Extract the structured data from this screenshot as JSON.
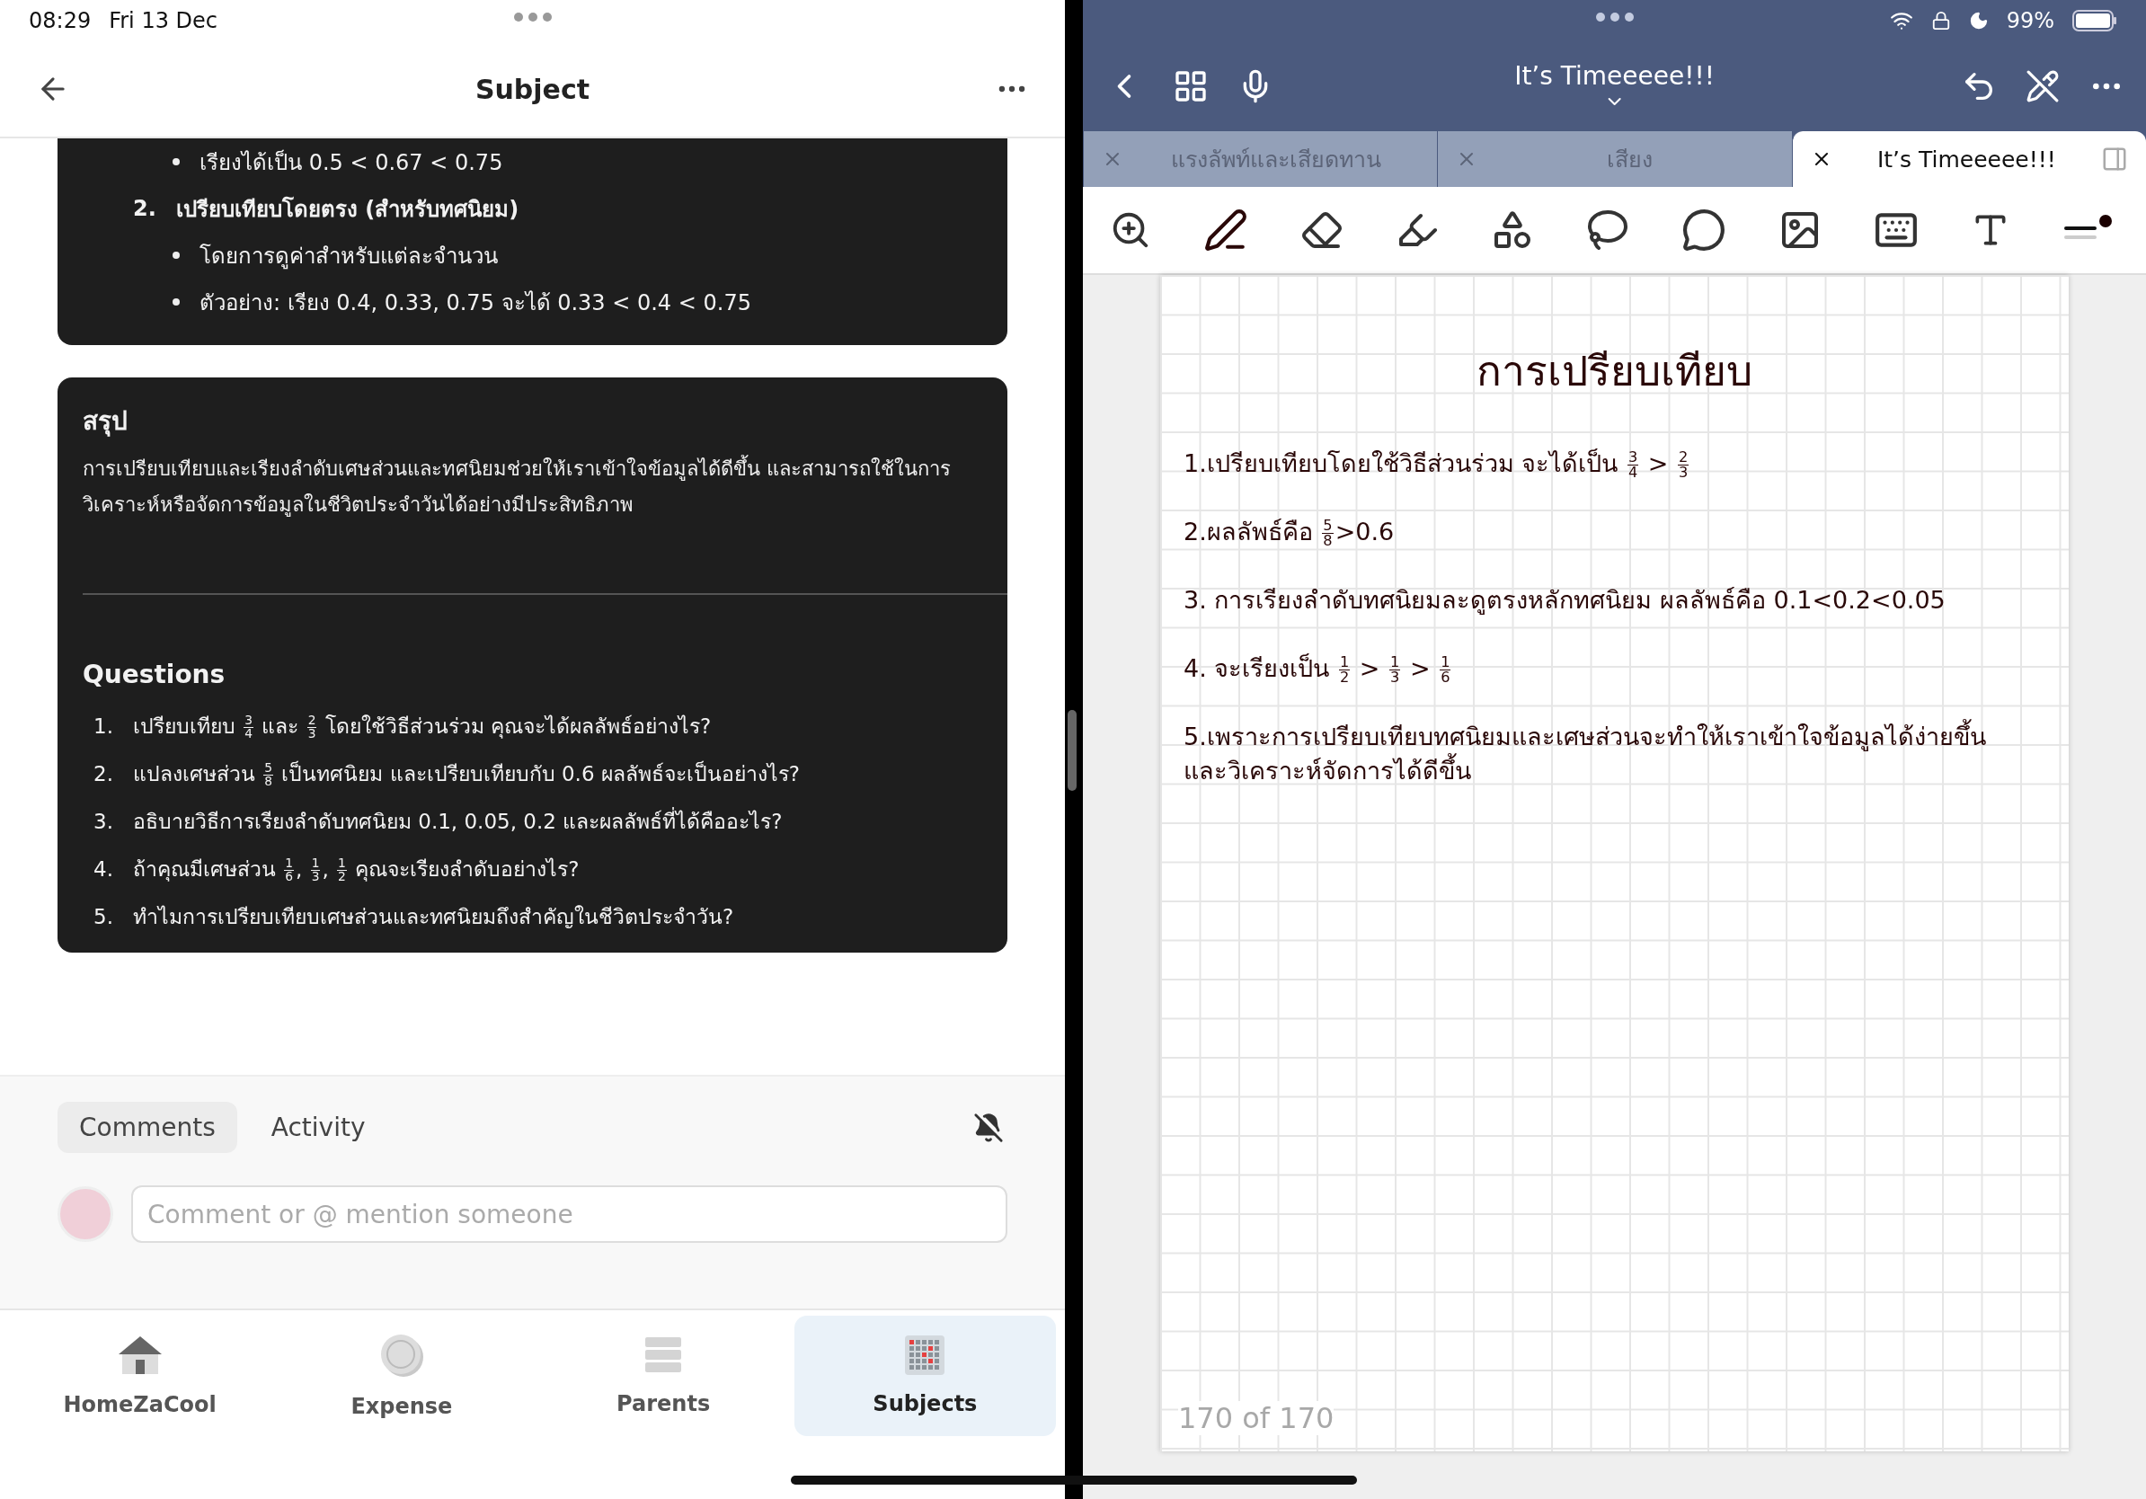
{
  "status_bar": {
    "time": "08:29",
    "date": "Fri 13 Dec",
    "battery": "99%"
  },
  "left": {
    "title": "Subject",
    "method_card": {
      "items": [
        {
          "kind": "bullet",
          "text": "เรียงได้เป็น 0.5 < 0.67 < 0.75"
        },
        {
          "kind": "numbered",
          "number": "2.",
          "text": "เปรียบเทียบโดยตรง (สำหรับทศนิยม)"
        },
        {
          "kind": "bullet",
          "text": "โดยการดูค่าสำหรับแต่ละจำนวน"
        },
        {
          "kind": "bullet",
          "text": "ตัวอย่าง: เรียง 0.4, 0.33, 0.75 จะได้ 0.33 < 0.4 < 0.75"
        }
      ]
    },
    "summary": {
      "heading": "สรุป",
      "text": "การเปรียบเทียบและเรียงลำดับเศษส่วนและทศนิยมช่วยให้เราเข้าใจข้อมูลได้ดีขึ้น และสามารถใช้ในการวิเคราะห์หรือจัดการข้อมูลในชีวิตประจำวันได้อย่างมีประสิทธิภาพ"
    },
    "questions": {
      "heading": "Questions",
      "items": [
        {
          "number": "1.",
          "parts": [
            "เปรียบเทียบ ",
            {
              "num": "3",
              "den": "4"
            },
            " และ ",
            {
              "num": "2",
              "den": "3"
            },
            " โดยใช้วิธีส่วนร่วม คุณจะได้ผลลัพธ์อย่างไร?"
          ]
        },
        {
          "number": "2.",
          "parts": [
            "แปลงเศษส่วน ",
            {
              "num": "5",
              "den": "8"
            },
            " เป็นทศนิยม และเปรียบเทียบกับ 0.6 ผลลัพธ์จะเป็นอย่างไร?"
          ]
        },
        {
          "number": "3.",
          "parts": [
            "อธิบายวิธีการเรียงลำดับทศนิยม 0.1, 0.05, 0.2 และผลลัพธ์ที่ได้คืออะไร?"
          ]
        },
        {
          "number": "4.",
          "parts": [
            "ถ้าคุณมีเศษส่วน ",
            {
              "num": "1",
              "den": "6"
            },
            ", ",
            {
              "num": "1",
              "den": "3"
            },
            ", ",
            {
              "num": "1",
              "den": "2"
            },
            " คุณจะเรียงลำดับอย่างไร?"
          ]
        },
        {
          "number": "5.",
          "parts": [
            "ทำไมการเปรียบเทียบเศษส่วนและทศนิยมถึงสำคัญในชีวิตประจำวัน?"
          ]
        }
      ]
    },
    "comment_tabs": [
      {
        "label": "Comments",
        "selected": true
      },
      {
        "label": "Activity",
        "selected": false
      }
    ],
    "comment_field": {
      "placeholder": "Comment or @ mention someone"
    },
    "nav": [
      {
        "label": "HomeZaCool",
        "kind": "house",
        "selected": false
      },
      {
        "label": "Expense",
        "kind": "coin",
        "selected": false
      },
      {
        "label": "Parents",
        "kind": "stack",
        "selected": false
      },
      {
        "label": "Subjects",
        "kind": "calendar",
        "selected": true
      }
    ]
  },
  "right": {
    "title": "It’s Timeeeee!!!",
    "tabs": [
      {
        "label": "แรงลัพท์และเสียดทาน",
        "selected": false
      },
      {
        "label": "เสียง",
        "selected": false
      },
      {
        "label": "It’s Timeeeee!!!",
        "selected": true
      }
    ],
    "note": {
      "title": "การเปรียบเทียบ",
      "lines": [
        {
          "parts": [
            "1.เปรียบเทียบโดยใช้วิธีส่วนร่วม จะได้เป็น ",
            {
              "num": "3",
              "den": "4"
            },
            " > ",
            {
              "num": "2",
              "den": "3"
            }
          ]
        },
        {
          "parts": [
            "2.ผลลัพธ์คือ  ",
            {
              "num": "5",
              "den": "8"
            },
            ">0.6"
          ]
        },
        {
          "parts": [
            "3. การเรียงลำดับทศนิยมละดูตรงหลักทศนิยม ผลลัพธ์คือ  0.1<0.2<0.05"
          ]
        },
        {
          "parts": [
            "4. จะเรียงเป็น  ",
            {
              "num": "1",
              "den": "2"
            },
            " > ",
            {
              "num": "1",
              "den": "3"
            },
            " > ",
            {
              "num": "1",
              "den": "6"
            }
          ]
        },
        {
          "parts": [
            "5.เพราะการเปรียบเทียบทศนิยมและเศษส่วนจะทำให้เราเข้าใจข้อมูลได้ง่ายขึ้น และวิเคราะห์จัดการได้ดีขึ้น"
          ]
        }
      ],
      "page_indicator": "170 of 170"
    }
  }
}
